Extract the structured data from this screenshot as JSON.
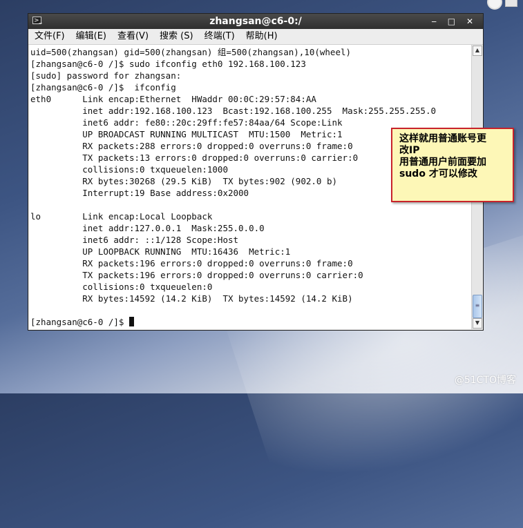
{
  "window": {
    "title": "zhangsan@c6-0:/",
    "controls": "‒ □ ✕"
  },
  "menubar": {
    "items": [
      "文件(F)",
      "编辑(E)",
      "查看(V)",
      "搜索 (S)",
      "终端(T)",
      "帮助(H)"
    ]
  },
  "terminal": {
    "lines": [
      "uid=500(zhangsan) gid=500(zhangsan) 组=500(zhangsan),10(wheel)",
      "[zhangsan@c6-0 /]$ sudo ifconfig eth0 192.168.100.123",
      "[sudo] password for zhangsan:",
      "[zhangsan@c6-0 /]$  ifconfig",
      "eth0      Link encap:Ethernet  HWaddr 00:0C:29:57:84:AA",
      "          inet addr:192.168.100.123  Bcast:192.168.100.255  Mask:255.255.255.0",
      "          inet6 addr: fe80::20c:29ff:fe57:84aa/64 Scope:Link",
      "          UP BROADCAST RUNNING MULTICAST  MTU:1500  Metric:1",
      "          RX packets:288 errors:0 dropped:0 overruns:0 frame:0",
      "          TX packets:13 errors:0 dropped:0 overruns:0 carrier:0",
      "          collisions:0 txqueuelen:1000",
      "          RX bytes:30268 (29.5 KiB)  TX bytes:902 (902.0 b)",
      "          Interrupt:19 Base address:0x2000",
      "",
      "lo        Link encap:Local Loopback",
      "          inet addr:127.0.0.1  Mask:255.0.0.0",
      "          inet6 addr: ::1/128 Scope:Host",
      "          UP LOOPBACK RUNNING  MTU:16436  Metric:1",
      "          RX packets:196 errors:0 dropped:0 overruns:0 frame:0",
      "          TX packets:196 errors:0 dropped:0 overruns:0 carrier:0",
      "          collisions:0 txqueuelen:0",
      "          RX bytes:14592 (14.2 KiB)  TX bytes:14592 (14.2 KiB)",
      ""
    ],
    "prompt": "[zhangsan@c6-0 /]$ "
  },
  "callout": {
    "lines": [
      "这样就用普通账号更",
      "改IP",
      "用普通用户前面要加",
      "sudo 才可以修改"
    ]
  },
  "watermark": "@51CTO博客",
  "icons": {
    "app": "terminal-icon",
    "scroll_up": "chevron-up-icon",
    "scroll_down": "chevron-down-icon"
  },
  "colors": {
    "callout_border": "#c8222a",
    "callout_bg": "#fdf7b7",
    "titlebar": "#3a3a3a"
  }
}
